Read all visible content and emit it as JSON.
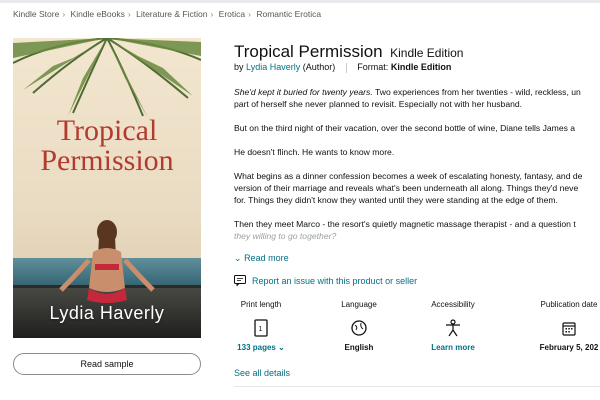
{
  "breadcrumb": [
    "Kindle Store",
    "Kindle eBooks",
    "Literature & Fiction",
    "Erotica",
    "Romantic Erotica"
  ],
  "cover": {
    "title_line1": "Tropical",
    "title_line2": "Permission",
    "author": "Lydia Haverly"
  },
  "read_sample_label": "Read sample",
  "product": {
    "title": "Tropical Permission",
    "edition": "Kindle Edition",
    "by": "by",
    "author": "Lydia Haverly",
    "author_role": "(Author)",
    "format_label": "Format:",
    "format_value": "Kindle Edition"
  },
  "description": {
    "p1_italic": "She'd kept it buried for twenty years.",
    "p1_rest": " Two experiences from her twenties - wild, reckless, un",
    "p1_line2": "part of herself she never planned to revisit. Especially not with her husband.",
    "p2": "But on the third night of their vacation, over the second bottle of wine, Diane tells James a",
    "p3": "He doesn't flinch. He wants to know more.",
    "p4_line1": "What begins as a dinner confession becomes a week of escalating honesty, fantasy, and de",
    "p4_line2": "version of their marriage and reveals what's been underneath all along. Things they'd neve",
    "p4_line3": "for. Things they didn't know they wanted until they were standing at the edge of them.",
    "p5_line1": "Then they meet Marco - the resort's quietly magnetic massage therapist - and a question t",
    "p5_line2": "they willing to go together?"
  },
  "read_more_label": "Read more",
  "report_label": "Report an issue with this product or seller",
  "details": [
    {
      "header": "Print length",
      "value": "133 pages",
      "icon": "book-pages-icon"
    },
    {
      "header": "Language",
      "value": "English",
      "icon": "globe-icon"
    },
    {
      "header": "Accessibility",
      "value": "Learn more",
      "icon": "accessibility-icon"
    },
    {
      "header": "Publication date",
      "value": "February 5, 202",
      "icon": "calendar-icon"
    }
  ],
  "see_all_label": "See all details",
  "colors": {
    "link": "#007185",
    "cover_title": "#b33a2f"
  }
}
